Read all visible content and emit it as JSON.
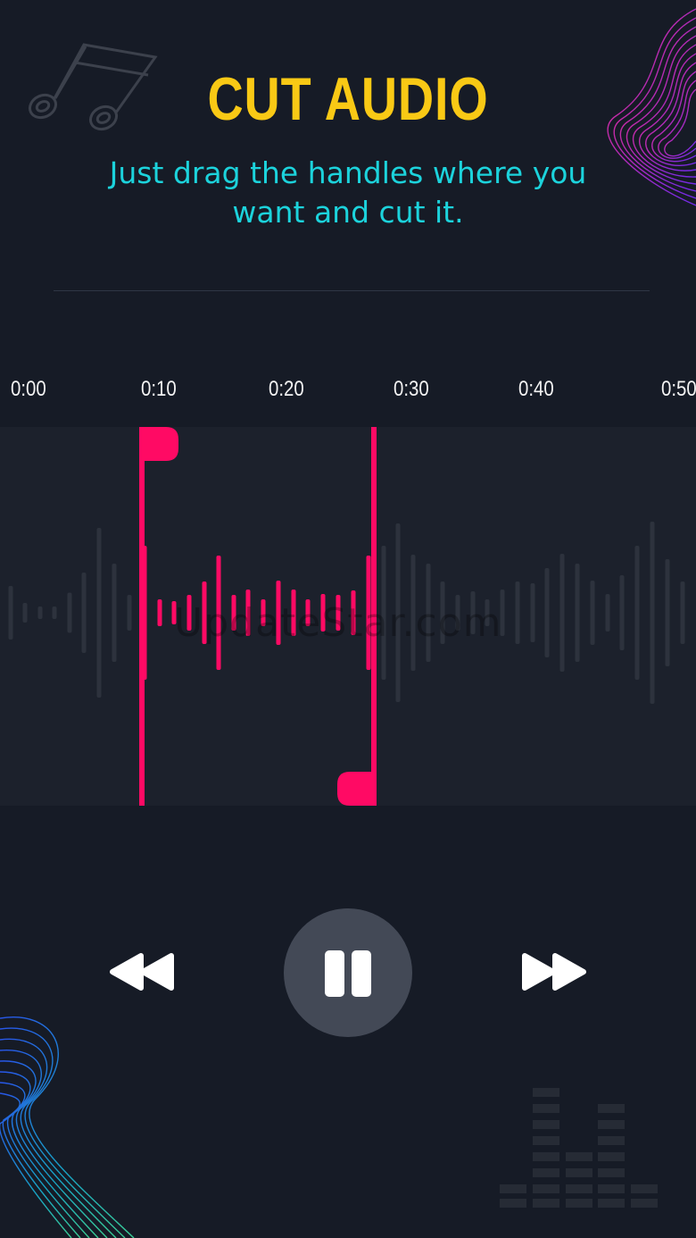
{
  "header": {
    "title": "CUT AUDIO",
    "subtitle": "Just drag the handles where you want and cut it."
  },
  "timeline": {
    "ticks": [
      "0:00",
      "0:10",
      "0:20",
      "0:30",
      "0:40",
      "0:50"
    ]
  },
  "waveform": {
    "watermark": "UpdateStar.com"
  },
  "colors": {
    "title": "#f9c915",
    "subtitle": "#1cd3dc",
    "accent": "#ff0a64",
    "background": "#161b26",
    "waveform_inactive": "#2d323d",
    "play_button": "#434956"
  },
  "icons": {
    "top_left": "music-note-icon",
    "rewind": "rewind-icon",
    "pause": "pause-icon",
    "fast_forward": "fast-forward-icon",
    "bottom_right": "equalizer-icon"
  }
}
